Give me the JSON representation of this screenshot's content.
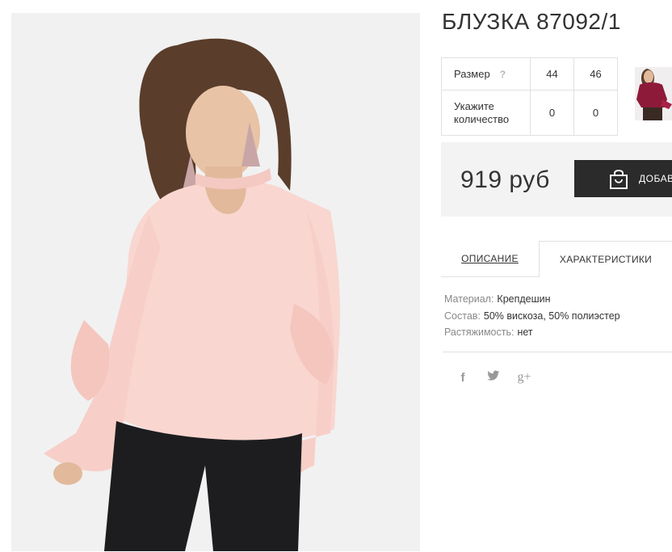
{
  "product": {
    "title": "БЛУЗКА 87092/1",
    "image_icon": "product-photo",
    "thumbnail_icon": "product-thumbnail"
  },
  "sizes": {
    "size_label": "Размер",
    "help_label": "?",
    "options": [
      "44",
      "46"
    ],
    "quantity_label_line1": "Укажите",
    "quantity_label_line2": "количество",
    "quantities": [
      "0",
      "0"
    ]
  },
  "price": {
    "value": "919 руб",
    "add_button_label": "ДОБАВ"
  },
  "tabs": [
    {
      "label": "ОПИСАНИЕ",
      "active": false
    },
    {
      "label": "ХАРАКТЕРИСТИКИ",
      "active": true
    }
  ],
  "characteristics": [
    {
      "key": "Материал:",
      "value": "Крепдешин"
    },
    {
      "key": "Состав:",
      "value": "50% вискоза, 50% полиэстер"
    },
    {
      "key": "Растяжимость:",
      "value": "нет"
    }
  ],
  "social": {
    "facebook": "f",
    "twitter": "twitter-icon",
    "google_plus": "g+"
  },
  "colors": {
    "button_bg": "#2b2b2b",
    "price_bg": "#f3f3f3",
    "border": "#e1e1e1",
    "blouse": "#f9d6d0"
  }
}
